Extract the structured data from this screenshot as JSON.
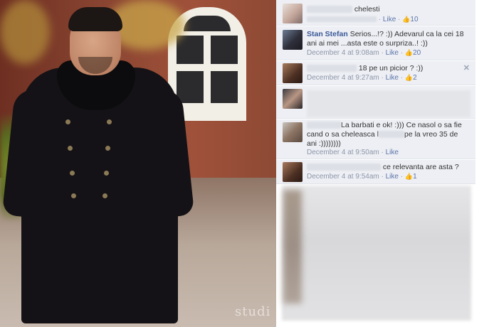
{
  "photo": {
    "watermark": "studi"
  },
  "comments": [
    {
      "name": "",
      "text": "chelesti",
      "time": "",
      "like": "Like",
      "likes": "10",
      "sep": "·"
    },
    {
      "name": "Stan Stefan",
      "text": "Serios...!? :)) Adevarul ca la cei 18 ani ai mei ...asta este o surpriza..! :))",
      "time": "December 4 at 9:08am",
      "like": "Like",
      "likes": "20",
      "sep": "·"
    },
    {
      "name": "",
      "text": "18 pe un picior ? :))",
      "time": "December 4 at 9:27am",
      "like": "Like",
      "likes": "2",
      "sep": "·"
    },
    {
      "name": "",
      "text": "",
      "time": "",
      "like": "",
      "likes": "",
      "sep": ""
    },
    {
      "name": "",
      "text_a": "La barbati e ok! :))) Ce nasol o sa fie cand o sa cheleasca l",
      "text_b": "pe la vreo 35 de ani :))))))))",
      "time": "December 4 at 9:50am",
      "like": "Like",
      "sep": "·"
    },
    {
      "name": "",
      "text": "ce relevanta are asta ?",
      "time": "December 4 at 9:54am",
      "like": "Like",
      "likes": "1",
      "sep": "·"
    }
  ],
  "icons": {
    "close": "close-icon",
    "thumb": "thumbs-up-icon"
  },
  "colors": {
    "link": "#3b5998",
    "comment_bg": "#edeff4",
    "meta": "#8d96a8"
  }
}
